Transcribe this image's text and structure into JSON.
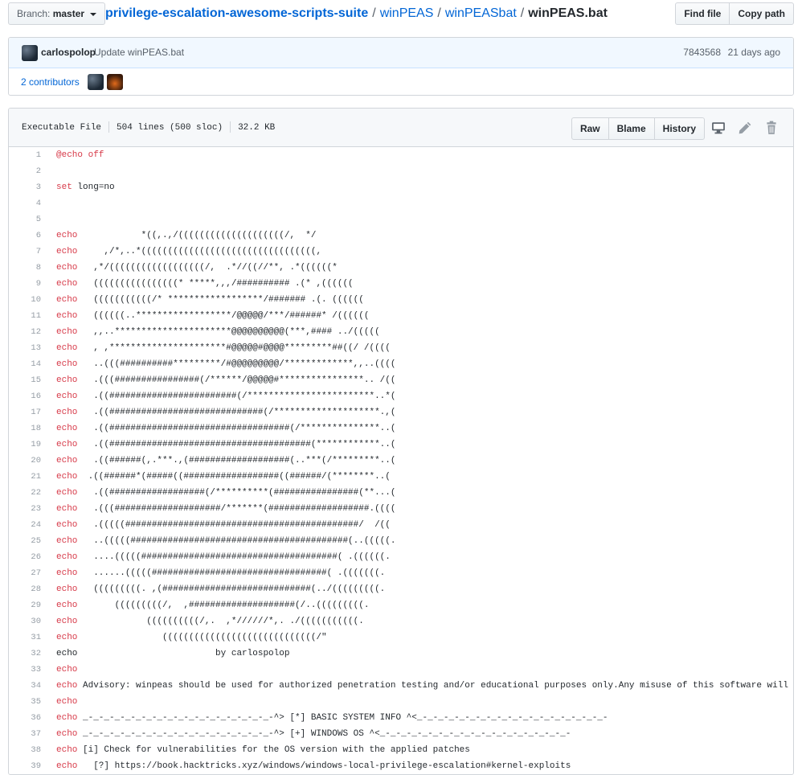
{
  "topbar": {
    "branch_prefix": "Branch:",
    "branch_name": "master",
    "breadcrumb": {
      "repo": "privilege-escalation-awesome-scripts-suite",
      "dir1": "winPEAS",
      "dir2": "winPEASbat",
      "file": "winPEAS.bat",
      "separator": "/"
    },
    "find_file": "Find file",
    "copy_path": "Copy path"
  },
  "commit": {
    "author": "carlospolop",
    "message": "Update winPEAS.bat",
    "sha": "7843568",
    "date": "21 days ago",
    "contributors": "2 contributors"
  },
  "file": {
    "type": "Executable File",
    "lines": "504 lines (500 sloc)",
    "size": "32.2 KB",
    "raw": "Raw",
    "blame": "Blame",
    "history": "History"
  },
  "code_lines": [
    {
      "n": "1",
      "kw": "@echo off",
      "text": ""
    },
    {
      "n": "2",
      "kw": "",
      "text": ""
    },
    {
      "n": "3",
      "kw": "set",
      "text": " long=no"
    },
    {
      "n": "4",
      "kw": "",
      "text": ""
    },
    {
      "n": "5",
      "kw": "",
      "text": ""
    },
    {
      "n": "6",
      "kw": "echo",
      "text": "            *((,.,/((((((((((((((((((((/,  */"
    },
    {
      "n": "7",
      "kw": "echo",
      "text": "     ,/*,..*(((((((((((((((((((((((((((((((((,"
    },
    {
      "n": "8",
      "kw": "echo",
      "text": "   ,*/((((((((((((((((((/,  .*//((//**, .*((((((*"
    },
    {
      "n": "9",
      "kw": "echo",
      "text": "   ((((((((((((((((* *****,,,/########## .(* ,(((((("
    },
    {
      "n": "10",
      "kw": "echo",
      "text": "   (((((((((((/* ******************/####### .(. (((((("
    },
    {
      "n": "11",
      "kw": "echo",
      "text": "   ((((((..******************/@@@@@/***/######* /(((((("
    },
    {
      "n": "12",
      "kw": "echo",
      "text": "   ,,..**********************@@@@@@@@@@(***,#### ../((((("
    },
    {
      "n": "13",
      "kw": "echo",
      "text": "   , ,**********************#@@@@@#@@@@*********##((/ /(((("
    },
    {
      "n": "14",
      "kw": "echo",
      "text": "   ..(((##########*********/#@@@@@@@@@/*************,,..(((("
    },
    {
      "n": "15",
      "kw": "echo",
      "text": "   .(((################(/******/@@@@@#****************.. /(("
    },
    {
      "n": "16",
      "kw": "echo",
      "text": "   .((########################(/************************..*("
    },
    {
      "n": "17",
      "kw": "echo",
      "text": "   .((#############################(/********************.,("
    },
    {
      "n": "18",
      "kw": "echo",
      "text": "   .((##################################(/***************..("
    },
    {
      "n": "19",
      "kw": "echo",
      "text": "   .((######################################(************..("
    },
    {
      "n": "20",
      "kw": "echo",
      "text": "   .((######(,.***.,(###################(..***(/*********..("
    },
    {
      "n": "21",
      "kw": "echo",
      "text": "  .((######*(#####((##################((######/(********..("
    },
    {
      "n": "22",
      "kw": "echo",
      "text": "   .((##################(/**********(################(**...("
    },
    {
      "n": "23",
      "kw": "echo",
      "text": "   .(((####################/*******(###################.(((("
    },
    {
      "n": "24",
      "kw": "echo",
      "text": "   .(((((############################################/  /(("
    },
    {
      "n": "25",
      "kw": "echo",
      "text": "   ..(((((#########################################(..(((((."
    },
    {
      "n": "26",
      "kw": "echo",
      "text": "   ....(((((#####################################( .((((((."
    },
    {
      "n": "27",
      "kw": "echo",
      "text": "   ......(((((#################################( .(((((((."
    },
    {
      "n": "28",
      "kw": "echo",
      "text": "   (((((((((. ,(############################(../(((((((((."
    },
    {
      "n": "29",
      "kw": "echo",
      "text": "       (((((((((/,  ,####################(/..(((((((((."
    },
    {
      "n": "30",
      "kw": "echo",
      "text": "             ((((((((((/,.  ,*//////*,. ./(((((((((((."
    },
    {
      "n": "31",
      "kw": "echo",
      "text": "                (((((((((((((((((((((((((((((/\""
    },
    {
      "n": "32",
      "kw": "echo",
      "text": "                          by carlospolop",
      "plain": true
    },
    {
      "n": "33",
      "kw": "echo",
      "text": ""
    },
    {
      "n": "34",
      "kw": "echo",
      "text": " Advisory: winpeas should be used for authorized penetration testing and/or educational purposes only.Any misuse of this software will be the responsibility of the user."
    },
    {
      "n": "35",
      "kw": "echo",
      "text": ""
    },
    {
      "n": "36",
      "kw": "echo",
      "text": " _-_-_-_-_-_-_-_-_-_-_-_-_-_-_-_-_-_-^> [*] BASIC SYSTEM INFO ^<_-_-_-_-_-_-_-_-_-_-_-_-_-_-_-_-_-_-"
    },
    {
      "n": "37",
      "kw": "echo",
      "text": " _-_-_-_-_-_-_-_-_-_-_-_-_-_-_-_-_-_-^> [+] WINDOWS OS ^<_-_-_-_-_-_-_-_-_-_-_-_-_-_-_-_-_-_-"
    },
    {
      "n": "38",
      "kw": "echo",
      "text": " [i] Check for vulnerabilities for the OS version with the applied patches"
    },
    {
      "n": "39",
      "kw": "echo",
      "text": "   [?] https://book.hacktricks.xyz/windows/windows-local-privilege-escalation#kernel-exploits"
    }
  ]
}
